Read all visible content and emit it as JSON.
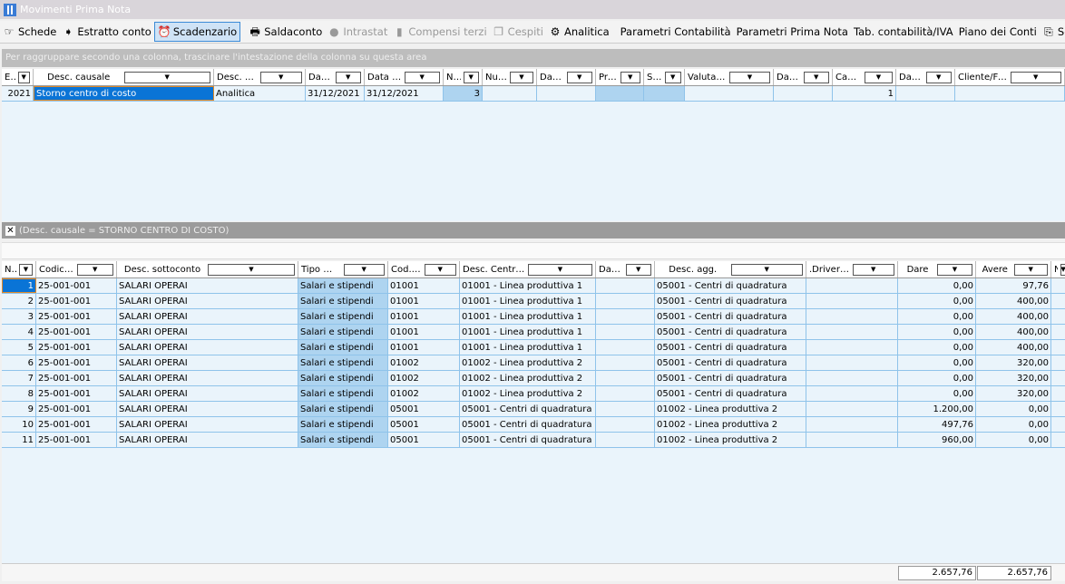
{
  "window": {
    "title": "Movimenti Prima Nota"
  },
  "toolbar": [
    {
      "label": "Schede",
      "icon": "hand-pointer-icon",
      "state": "normal",
      "glyph": "☞"
    },
    {
      "label": "Estratto conto",
      "icon": "document-arrow-icon",
      "state": "normal",
      "glyph": "➧"
    },
    {
      "label": "Scadenzario",
      "icon": "alarm-clock-icon",
      "state": "active",
      "glyph": "⏰"
    },
    {
      "sep": true
    },
    {
      "label": "Saldaconto",
      "icon": "printer-icon",
      "state": "normal",
      "glyph": "🖶"
    },
    {
      "label": "Intrastat",
      "icon": "circle-icon",
      "state": "disabled",
      "glyph": "●"
    },
    {
      "label": "Compensi terzi",
      "icon": "bar-icon",
      "state": "disabled",
      "glyph": "▮"
    },
    {
      "label": "Cespiti",
      "icon": "assets-icon",
      "state": "disabled",
      "glyph": "❐"
    },
    {
      "label": "Analitica",
      "icon": "hierarchy-icon",
      "state": "normal",
      "glyph": "⚙"
    },
    {
      "sep": true
    },
    {
      "label": "Parametri Contabilità",
      "state": "normal"
    },
    {
      "label": "Parametri Prima Nota",
      "state": "normal"
    },
    {
      "label": "Tab. contabilità/IVA",
      "state": "normal"
    },
    {
      "label": "Piano dei Conti",
      "state": "normal"
    },
    {
      "label": "Sch",
      "icon": "copy-icon",
      "state": "normal",
      "glyph": "⎘"
    }
  ],
  "group_panel": "Per raggruppare secondo una colonna, trascinare l'intestazione della colonna su questa area",
  "top_grid": {
    "columns": [
      "E...",
      "Desc. causale",
      "Desc. simulazione",
      "Data ... /",
      "Data compet...",
      "Nu...",
      "Num. d...",
      "Data doc.",
      "Proto...",
      "Sbil...",
      "Valuta extra",
      "Data val...",
      "Cambio",
      "Data ric...",
      "Cliente/Fornitore"
    ],
    "rows": [
      [
        "2021",
        "Storno centro di costo",
        "Analitica",
        "31/12/2021",
        "31/12/2021",
        "3",
        "",
        "",
        "",
        "",
        "",
        "",
        "1",
        "",
        ""
      ]
    ]
  },
  "filter": {
    "text": "(Desc. causale = STORNO CENTRO DI COSTO)"
  },
  "bottom_grid": {
    "columns": [
      "N°...",
      "Codice sottoc...",
      "Desc. sottoconto",
      "Tipo movimento",
      "Cod. Centr...",
      "Desc. Centro di Costo",
      "Data ana...",
      "Desc. agg.",
      ".Driver di riparto...",
      "Dare",
      "Avere",
      "Nu"
    ],
    "rows": [
      [
        "1",
        "25-001-001",
        "SALARI OPERAI",
        "Salari e stipendi",
        "01001",
        "01001 - Linea produttiva 1",
        "",
        "05001 - Centri di quadratura",
        "",
        "0,00",
        "97,76",
        ""
      ],
      [
        "2",
        "25-001-001",
        "SALARI OPERAI",
        "Salari e stipendi",
        "01001",
        "01001 - Linea produttiva 1",
        "",
        "05001 - Centri di quadratura",
        "",
        "0,00",
        "400,00",
        ""
      ],
      [
        "3",
        "25-001-001",
        "SALARI OPERAI",
        "Salari e stipendi",
        "01001",
        "01001 - Linea produttiva 1",
        "",
        "05001 - Centri di quadratura",
        "",
        "0,00",
        "400,00",
        ""
      ],
      [
        "4",
        "25-001-001",
        "SALARI OPERAI",
        "Salari e stipendi",
        "01001",
        "01001 - Linea produttiva 1",
        "",
        "05001 - Centri di quadratura",
        "",
        "0,00",
        "400,00",
        ""
      ],
      [
        "5",
        "25-001-001",
        "SALARI OPERAI",
        "Salari e stipendi",
        "01001",
        "01001 - Linea produttiva 1",
        "",
        "05001 - Centri di quadratura",
        "",
        "0,00",
        "400,00",
        ""
      ],
      [
        "6",
        "25-001-001",
        "SALARI OPERAI",
        "Salari e stipendi",
        "01002",
        "01002 - Linea produttiva 2",
        "",
        "05001 - Centri di quadratura",
        "",
        "0,00",
        "320,00",
        ""
      ],
      [
        "7",
        "25-001-001",
        "SALARI OPERAI",
        "Salari e stipendi",
        "01002",
        "01002 - Linea produttiva 2",
        "",
        "05001 - Centri di quadratura",
        "",
        "0,00",
        "320,00",
        ""
      ],
      [
        "8",
        "25-001-001",
        "SALARI OPERAI",
        "Salari e stipendi",
        "01002",
        "01002 - Linea produttiva 2",
        "",
        "05001 - Centri di quadratura",
        "",
        "0,00",
        "320,00",
        ""
      ],
      [
        "9",
        "25-001-001",
        "SALARI OPERAI",
        "Salari e stipendi",
        "05001",
        "05001 - Centri di quadratura",
        "",
        "01002 - Linea produttiva 2",
        "",
        "1.200,00",
        "0,00",
        ""
      ],
      [
        "10",
        "25-001-001",
        "SALARI OPERAI",
        "Salari e stipendi",
        "05001",
        "05001 - Centri di quadratura",
        "",
        "01002 - Linea produttiva 2",
        "",
        "497,76",
        "0,00",
        ""
      ],
      [
        "11",
        "25-001-001",
        "SALARI OPERAI",
        "Salari e stipendi",
        "05001",
        "05001 - Centri di quadratura",
        "",
        "01002 - Linea produttiva 2",
        "",
        "960,00",
        "0,00",
        ""
      ]
    ]
  },
  "totals": {
    "dare": "2.657,76",
    "avere": "2.657,76"
  }
}
